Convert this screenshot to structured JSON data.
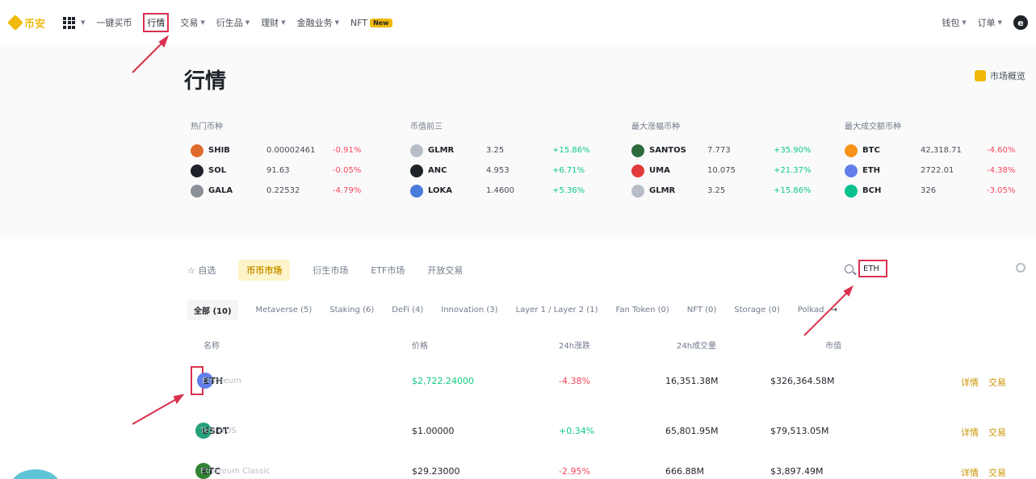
{
  "nav": {
    "logo": "币安",
    "items": [
      {
        "label": "一键买币",
        "caret": false
      },
      {
        "label": "行情",
        "caret": false,
        "active": true
      },
      {
        "label": "交易",
        "caret": true
      },
      {
        "label": "衍生品",
        "caret": true
      },
      {
        "label": "理财",
        "caret": true
      },
      {
        "label": "金融业务",
        "caret": true
      },
      {
        "label": "NFT",
        "caret": false,
        "badge": "New"
      }
    ],
    "right": [
      "钱包",
      "订单"
    ],
    "avatar": "e"
  },
  "page_title": "行情",
  "overview_label": "市场概览",
  "highlights": [
    {
      "title": "热门币种",
      "rows": [
        {
          "symbol": "SHIB",
          "price": "0.00002461",
          "change": "-0.91%",
          "dir": "down",
          "color": "#e06a2c"
        },
        {
          "symbol": "SOL",
          "price": "91.63",
          "change": "-0.05%",
          "dir": "down",
          "color": "#1e2329"
        },
        {
          "symbol": "GALA",
          "price": "0.22532",
          "change": "-4.79%",
          "dir": "down",
          "color": "#8a8f98"
        }
      ]
    },
    {
      "title": "币值前三",
      "rows": [
        {
          "symbol": "GLMR",
          "price": "3.25",
          "change": "+15.86%",
          "dir": "up",
          "color": "#b7bdc6"
        },
        {
          "symbol": "ANC",
          "price": "4.953",
          "change": "+6.71%",
          "dir": "up",
          "color": "#1e2329"
        },
        {
          "symbol": "LOKA",
          "price": "1.4600",
          "change": "+5.36%",
          "dir": "up",
          "color": "#4b7bdb"
        }
      ]
    },
    {
      "title": "最大涨幅币种",
      "rows": [
        {
          "symbol": "SANTOS",
          "price": "7.773",
          "change": "+35.90%",
          "dir": "up",
          "color": "#2e6b3b"
        },
        {
          "symbol": "UMA",
          "price": "10.075",
          "change": "+21.37%",
          "dir": "up",
          "color": "#e03a3a"
        },
        {
          "symbol": "GLMR",
          "price": "3.25",
          "change": "+15.86%",
          "dir": "up",
          "color": "#b7bdc6"
        }
      ]
    },
    {
      "title": "最大成交额币种",
      "rows": [
        {
          "symbol": "BTC",
          "price": "42,318.71",
          "change": "-4.60%",
          "dir": "down",
          "color": "#f7931a"
        },
        {
          "symbol": "ETH",
          "price": "2722.01",
          "change": "-4.38%",
          "dir": "down",
          "color": "#627eea"
        },
        {
          "symbol": "BCH",
          "price": "326",
          "change": "-3.05%",
          "dir": "down",
          "color": "#0ac18e"
        }
      ]
    }
  ],
  "tabs": [
    "自选",
    "币币市场",
    "衍生市场",
    "ETF市场",
    "开放交易"
  ],
  "active_tab": 1,
  "search": {
    "value": "ETH"
  },
  "chips": [
    "全部 (10)",
    "Metaverse (5)",
    "Staking (6)",
    "DeFi (4)",
    "Innovation (3)",
    "Layer 1 / Layer 2 (1)",
    "Fan Token (0)",
    "NFT (0)",
    "Storage (0)",
    "Polkad"
  ],
  "table": {
    "headers": [
      "名称",
      "价格",
      "24h涨跌",
      "24h成交量",
      "市值"
    ],
    "rows": [
      {
        "symbol": "ETH",
        "name": "Ethereum",
        "price": "$2,722.24000",
        "change": "-4.38%",
        "dir": "down",
        "volume": "16,351.38M",
        "mcap": "$326,364.58M",
        "color": "#627eea"
      },
      {
        "symbol": "USDT",
        "name": "TetherUS",
        "price": "$1.00000",
        "change": "+0.34%",
        "dir": "up",
        "volume": "65,801.95M",
        "mcap": "$79,513.05M",
        "color": "#26a17b"
      },
      {
        "symbol": "ETC",
        "name": "Ethereum Classic",
        "price": "$29.23000",
        "change": "-2.95%",
        "dir": "down",
        "volume": "666.88M",
        "mcap": "$3,897.49M",
        "color": "#328332"
      }
    ],
    "actions": [
      "详情",
      "交易"
    ]
  }
}
